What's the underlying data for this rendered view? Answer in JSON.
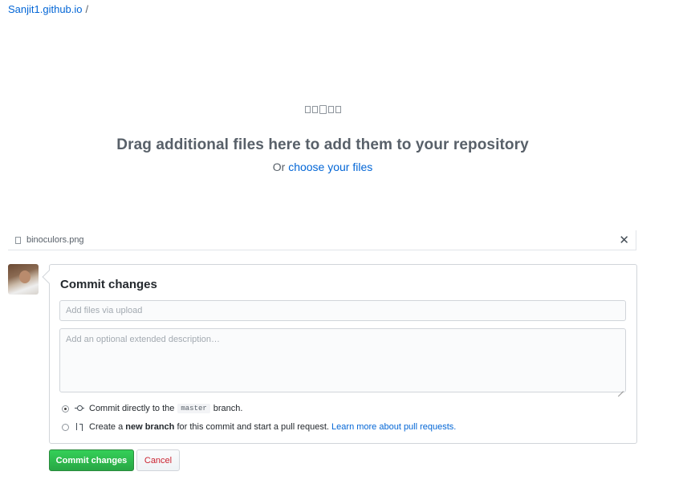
{
  "breadcrumb": {
    "repo": "Sanjit1.github.io",
    "separator": "/"
  },
  "dropzone": {
    "icons": [
      "file-icon",
      "file-media-icon",
      "file-code-icon",
      "file-text-icon",
      "file-zip-icon"
    ],
    "title": "Drag additional files here to add them to your repository",
    "sub_prefix": "Or",
    "sub_link": "choose your files"
  },
  "uploaded_file": {
    "name": "binoculors.png"
  },
  "commit": {
    "title": "Commit changes",
    "summary_placeholder": "Add files via upload",
    "description_placeholder": "Add an optional extended description…",
    "option_direct": {
      "selected": true,
      "prefix": "Commit directly to the",
      "branch": "master",
      "suffix": "branch."
    },
    "option_new_branch": {
      "selected": false,
      "prefix": "Create a",
      "bold": "new branch",
      "middle": "for this commit and start a pull request.",
      "link": "Learn more about pull requests."
    },
    "submit_label": "Commit changes",
    "cancel_label": "Cancel"
  },
  "colors": {
    "link": "#0366d6",
    "primary_button": "#28a745",
    "cancel_text": "#cb2431"
  }
}
